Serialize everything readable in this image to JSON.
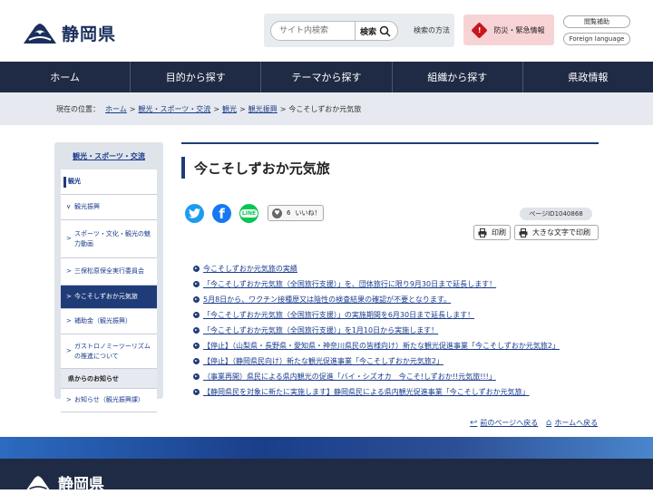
{
  "site": {
    "logo_text": "静岡県"
  },
  "header": {
    "search_placeholder": "サイト内検索",
    "search_button": "検索",
    "search_help": "検索の方法",
    "disaster_label": "防災・緊急情報",
    "accessibility_label": "閲覧補助",
    "foreign_label": "Foreign language",
    "disaster_color": "#c8161d"
  },
  "nav": {
    "items": [
      "ホーム",
      "目的から探す",
      "テーマから探す",
      "組織から探す",
      "県政情報"
    ]
  },
  "breadcrumb": {
    "prefix": "現在の位置：",
    "items": [
      "ホーム",
      "観光・スポーツ・交流",
      "観光",
      "観光振興"
    ],
    "current": "今こそしずおか元気旅"
  },
  "sidebar": {
    "title": "観光・スポーツ・交流",
    "category": "観光",
    "subcategory": "観光振興",
    "items": [
      "スポーツ・文化・観光の魅力動画",
      "三保松原保全実行委員会",
      "今こそしずおか元気旅",
      "補助金（観光振興）",
      "ガストロノミーツーリズムの推進について"
    ],
    "notice_header": "県からのお知らせ",
    "notice_item": "お知らせ（観光振興課）"
  },
  "main": {
    "title": "今こそしずおか元気旅",
    "like_count": "6",
    "like_label": "いいね！",
    "page_id": "ページID1040868",
    "print_label": "印刷",
    "large_print_label": "大きな文字で印刷",
    "links": [
      "今こそしずおか元気旅の実績",
      "「今こそしずおか元気旅（全国旅行支援）」を、団体旅行に限り9月30日まで延長します！",
      "5月8日から、ワクチン接種歴又は陰性の検査結果の確認が不要となります。",
      "「今こそしずおか元気旅（全国旅行支援）」の実施期間を6月30日まで延長します！",
      "「今こそしずおか元気旅（全国旅行支援）」を1月10日から実施します！",
      "【停止】（山梨県・長野県・愛知県・神奈川県民の皆様向け）新たな観光促進事業「今こそしずおか元気旅2」",
      "【停止】（静岡県民向け）新たな観光促進事業「今こそしずおか元気旅2」",
      "（事業再開）県民による県内観光の促進「バイ・シズオカ　今こそ!しずおか!!元気旅!!!」",
      "【静岡県民を対象に新たに実施します】静岡県民による県内観光促進事業「今こそしずおか元気旅」"
    ],
    "back_label": "前のページへ戻る",
    "home_label": "ホームへ戻る"
  }
}
